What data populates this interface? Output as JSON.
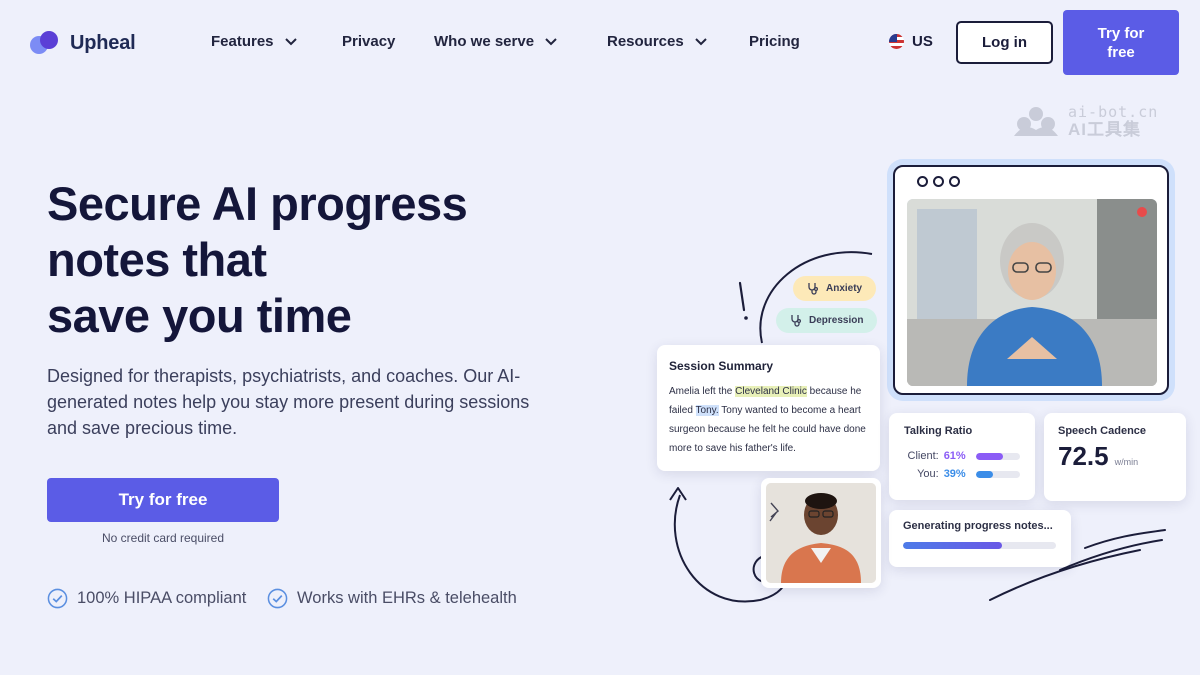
{
  "brand": {
    "name": "Upheal"
  },
  "nav": {
    "items": [
      {
        "label": "Features",
        "has_dropdown": true
      },
      {
        "label": "Privacy",
        "has_dropdown": false
      },
      {
        "label": "Who we serve",
        "has_dropdown": true
      },
      {
        "label": "Resources",
        "has_dropdown": true
      },
      {
        "label": "Pricing",
        "has_dropdown": false
      }
    ],
    "region": "US",
    "login_label": "Log in",
    "try_label": "Try for free"
  },
  "watermark": {
    "line1": "ai-bot.cn",
    "line2": "AI工具集"
  },
  "hero": {
    "title_line1": "Secure AI progress",
    "title_line2": "notes that",
    "title_line3": "save you time",
    "subtitle": "Designed for therapists, psychiatrists, and coaches. Our AI-generated notes help you stay more present during sessions and save precious time.",
    "cta_label": "Try for free",
    "cta_note": "No credit card required",
    "features": [
      "100% HIPAA compliant",
      "Works with EHRs & telehealth"
    ]
  },
  "illustration": {
    "tags": [
      "Anxiety",
      "Depression"
    ],
    "summary": {
      "title": "Session Summary",
      "text_before": "Amelia left the ",
      "highlight1": "Cleveland Clinic",
      "text_mid1": " because he failed ",
      "highlight2": "Tony.",
      "text_after": " Tony wanted to become a heart surgeon because he felt he could have done more to save his father's life."
    },
    "talking_ratio": {
      "title": "Talking Ratio",
      "rows": [
        {
          "label": "Client:",
          "value": "61%",
          "fraction": 0.61,
          "color": "#8b5cf6"
        },
        {
          "label": "You:",
          "value": "39%",
          "fraction": 0.39,
          "color": "#3b8de8"
        }
      ]
    },
    "speech_cadence": {
      "title": "Speech Cadence",
      "value": "72.5",
      "unit": "w/min"
    },
    "progress_notes": {
      "title": "Generating progress notes...",
      "fraction": 0.65
    },
    "colors": {
      "accent": "#5b5ce6",
      "dark": "#1b1d3a",
      "tag_anxiety": "#fde9b8",
      "tag_depression": "#d3f0ea"
    }
  }
}
